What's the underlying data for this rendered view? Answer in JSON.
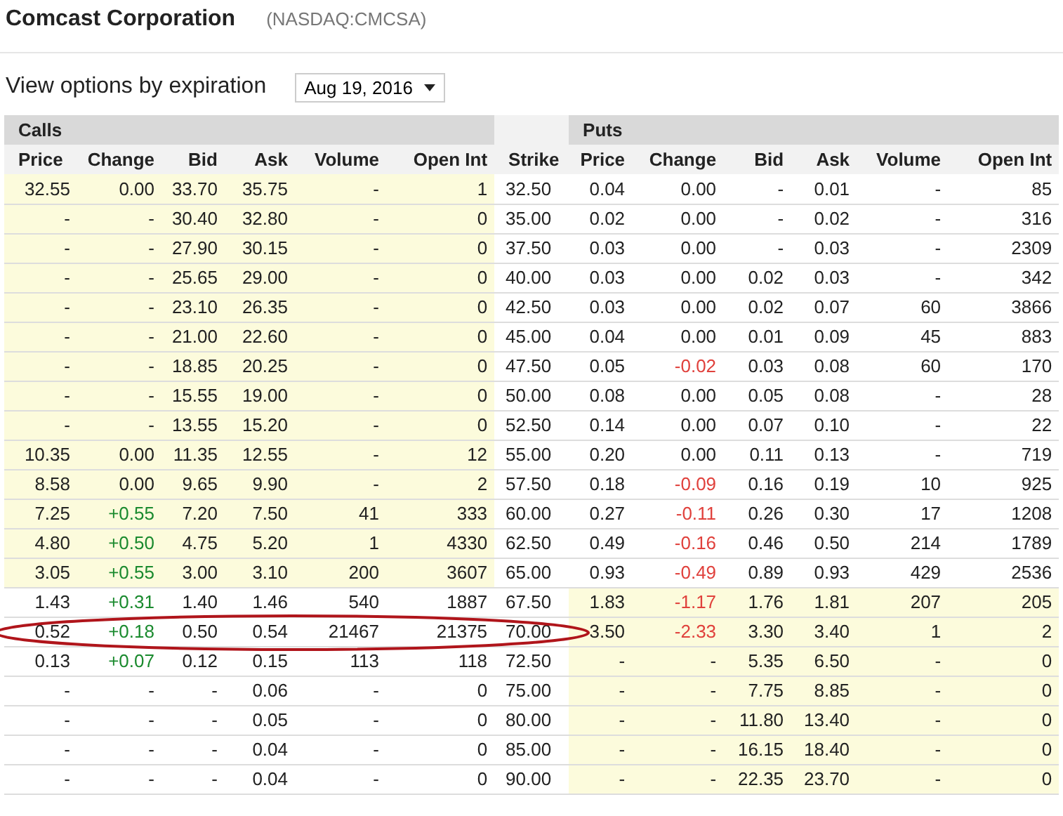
{
  "company": {
    "name": "Comcast Corporation",
    "ticker": "(NASDAQ:CMCSA)"
  },
  "expiration": {
    "label": "View options by expiration",
    "value": "Aug 19, 2016"
  },
  "table": {
    "calls_title": "Calls",
    "puts_title": "Puts",
    "call_columns": [
      "Price",
      "Change",
      "Bid",
      "Ask",
      "Volume",
      "Open Int"
    ],
    "strike_column": "Strike",
    "put_columns": [
      "Price",
      "Change",
      "Bid",
      "Ask",
      "Volume",
      "Open Int"
    ],
    "rows": [
      {
        "strike": "32.50",
        "circled": false,
        "call": {
          "price": "32.55",
          "change": {
            "value": "0.00",
            "color": "#222222"
          },
          "bid": "33.70",
          "ask": "35.75",
          "volume": "-",
          "open_int": "1",
          "in_the_money": true
        },
        "put": {
          "price": "0.04",
          "change": {
            "value": "0.00",
            "color": "#222222"
          },
          "bid": "-",
          "ask": "0.01",
          "volume": "-",
          "open_int": "85",
          "in_the_money": false
        }
      },
      {
        "strike": "35.00",
        "circled": false,
        "call": {
          "price": "-",
          "change": {
            "value": "-",
            "color": "#222222"
          },
          "bid": "30.40",
          "ask": "32.80",
          "volume": "-",
          "open_int": "0",
          "in_the_money": true
        },
        "put": {
          "price": "0.02",
          "change": {
            "value": "0.00",
            "color": "#222222"
          },
          "bid": "-",
          "ask": "0.02",
          "volume": "-",
          "open_int": "316",
          "in_the_money": false
        }
      },
      {
        "strike": "37.50",
        "circled": false,
        "call": {
          "price": "-",
          "change": {
            "value": "-",
            "color": "#222222"
          },
          "bid": "27.90",
          "ask": "30.15",
          "volume": "-",
          "open_int": "0",
          "in_the_money": true
        },
        "put": {
          "price": "0.03",
          "change": {
            "value": "0.00",
            "color": "#222222"
          },
          "bid": "-",
          "ask": "0.03",
          "volume": "-",
          "open_int": "2309",
          "in_the_money": false
        }
      },
      {
        "strike": "40.00",
        "circled": false,
        "call": {
          "price": "-",
          "change": {
            "value": "-",
            "color": "#222222"
          },
          "bid": "25.65",
          "ask": "29.00",
          "volume": "-",
          "open_int": "0",
          "in_the_money": true
        },
        "put": {
          "price": "0.03",
          "change": {
            "value": "0.00",
            "color": "#222222"
          },
          "bid": "0.02",
          "ask": "0.03",
          "volume": "-",
          "open_int": "342",
          "in_the_money": false
        }
      },
      {
        "strike": "42.50",
        "circled": false,
        "call": {
          "price": "-",
          "change": {
            "value": "-",
            "color": "#222222"
          },
          "bid": "23.10",
          "ask": "26.35",
          "volume": "-",
          "open_int": "0",
          "in_the_money": true
        },
        "put": {
          "price": "0.03",
          "change": {
            "value": "0.00",
            "color": "#222222"
          },
          "bid": "0.02",
          "ask": "0.07",
          "volume": "60",
          "open_int": "3866",
          "in_the_money": false
        }
      },
      {
        "strike": "45.00",
        "circled": false,
        "call": {
          "price": "-",
          "change": {
            "value": "-",
            "color": "#222222"
          },
          "bid": "21.00",
          "ask": "22.60",
          "volume": "-",
          "open_int": "0",
          "in_the_money": true
        },
        "put": {
          "price": "0.04",
          "change": {
            "value": "0.00",
            "color": "#222222"
          },
          "bid": "0.01",
          "ask": "0.09",
          "volume": "45",
          "open_int": "883",
          "in_the_money": false
        }
      },
      {
        "strike": "47.50",
        "circled": false,
        "call": {
          "price": "-",
          "change": {
            "value": "-",
            "color": "#222222"
          },
          "bid": "18.85",
          "ask": "20.25",
          "volume": "-",
          "open_int": "0",
          "in_the_money": true
        },
        "put": {
          "price": "0.05",
          "change": {
            "value": "-0.02",
            "color": "#e0413c"
          },
          "bid": "0.03",
          "ask": "0.08",
          "volume": "60",
          "open_int": "170",
          "in_the_money": false
        }
      },
      {
        "strike": "50.00",
        "circled": false,
        "call": {
          "price": "-",
          "change": {
            "value": "-",
            "color": "#222222"
          },
          "bid": "15.55",
          "ask": "19.00",
          "volume": "-",
          "open_int": "0",
          "in_the_money": true
        },
        "put": {
          "price": "0.08",
          "change": {
            "value": "0.00",
            "color": "#222222"
          },
          "bid": "0.05",
          "ask": "0.08",
          "volume": "-",
          "open_int": "28",
          "in_the_money": false
        }
      },
      {
        "strike": "52.50",
        "circled": false,
        "call": {
          "price": "-",
          "change": {
            "value": "-",
            "color": "#222222"
          },
          "bid": "13.55",
          "ask": "15.20",
          "volume": "-",
          "open_int": "0",
          "in_the_money": true
        },
        "put": {
          "price": "0.14",
          "change": {
            "value": "0.00",
            "color": "#222222"
          },
          "bid": "0.07",
          "ask": "0.10",
          "volume": "-",
          "open_int": "22",
          "in_the_money": false
        }
      },
      {
        "strike": "55.00",
        "circled": false,
        "call": {
          "price": "10.35",
          "change": {
            "value": "0.00",
            "color": "#222222"
          },
          "bid": "11.35",
          "ask": "12.55",
          "volume": "-",
          "open_int": "12",
          "in_the_money": true
        },
        "put": {
          "price": "0.20",
          "change": {
            "value": "0.00",
            "color": "#222222"
          },
          "bid": "0.11",
          "ask": "0.13",
          "volume": "-",
          "open_int": "719",
          "in_the_money": false
        }
      },
      {
        "strike": "57.50",
        "circled": false,
        "call": {
          "price": "8.58",
          "change": {
            "value": "0.00",
            "color": "#222222"
          },
          "bid": "9.65",
          "ask": "9.90",
          "volume": "-",
          "open_int": "2",
          "in_the_money": true
        },
        "put": {
          "price": "0.18",
          "change": {
            "value": "-0.09",
            "color": "#e0413c"
          },
          "bid": "0.16",
          "ask": "0.19",
          "volume": "10",
          "open_int": "925",
          "in_the_money": false
        }
      },
      {
        "strike": "60.00",
        "circled": false,
        "call": {
          "price": "7.25",
          "change": {
            "value": "+0.55",
            "color": "#1a8a2e"
          },
          "bid": "7.20",
          "ask": "7.50",
          "volume": "41",
          "open_int": "333",
          "in_the_money": true
        },
        "put": {
          "price": "0.27",
          "change": {
            "value": "-0.11",
            "color": "#e0413c"
          },
          "bid": "0.26",
          "ask": "0.30",
          "volume": "17",
          "open_int": "1208",
          "in_the_money": false
        }
      },
      {
        "strike": "62.50",
        "circled": false,
        "call": {
          "price": "4.80",
          "change": {
            "value": "+0.50",
            "color": "#1a8a2e"
          },
          "bid": "4.75",
          "ask": "5.20",
          "volume": "1",
          "open_int": "4330",
          "in_the_money": true
        },
        "put": {
          "price": "0.49",
          "change": {
            "value": "-0.16",
            "color": "#e0413c"
          },
          "bid": "0.46",
          "ask": "0.50",
          "volume": "214",
          "open_int": "1789",
          "in_the_money": false
        }
      },
      {
        "strike": "65.00",
        "circled": false,
        "call": {
          "price": "3.05",
          "change": {
            "value": "+0.55",
            "color": "#1a8a2e"
          },
          "bid": "3.00",
          "ask": "3.10",
          "volume": "200",
          "open_int": "3607",
          "in_the_money": true
        },
        "put": {
          "price": "0.93",
          "change": {
            "value": "-0.49",
            "color": "#e0413c"
          },
          "bid": "0.89",
          "ask": "0.93",
          "volume": "429",
          "open_int": "2536",
          "in_the_money": false
        }
      },
      {
        "strike": "67.50",
        "circled": false,
        "call": {
          "price": "1.43",
          "change": {
            "value": "+0.31",
            "color": "#1a8a2e"
          },
          "bid": "1.40",
          "ask": "1.46",
          "volume": "540",
          "open_int": "1887",
          "in_the_money": false
        },
        "put": {
          "price": "1.83",
          "change": {
            "value": "-1.17",
            "color": "#e0413c"
          },
          "bid": "1.76",
          "ask": "1.81",
          "volume": "207",
          "open_int": "205",
          "in_the_money": true
        }
      },
      {
        "strike": "70.00",
        "circled": true,
        "call": {
          "price": "0.52",
          "change": {
            "value": "+0.18",
            "color": "#1a8a2e"
          },
          "bid": "0.50",
          "ask": "0.54",
          "volume": "21467",
          "open_int": "21375",
          "in_the_money": false
        },
        "put": {
          "price": "3.50",
          "change": {
            "value": "-2.33",
            "color": "#e0413c"
          },
          "bid": "3.30",
          "ask": "3.40",
          "volume": "1",
          "open_int": "2",
          "in_the_money": true
        }
      },
      {
        "strike": "72.50",
        "circled": false,
        "call": {
          "price": "0.13",
          "change": {
            "value": "+0.07",
            "color": "#1a8a2e"
          },
          "bid": "0.12",
          "ask": "0.15",
          "volume": "113",
          "open_int": "118",
          "in_the_money": false
        },
        "put": {
          "price": "-",
          "change": {
            "value": "-",
            "color": "#222222"
          },
          "bid": "5.35",
          "ask": "6.50",
          "volume": "-",
          "open_int": "0",
          "in_the_money": true
        }
      },
      {
        "strike": "75.00",
        "circled": false,
        "call": {
          "price": "-",
          "change": {
            "value": "-",
            "color": "#222222"
          },
          "bid": "-",
          "ask": "0.06",
          "volume": "-",
          "open_int": "0",
          "in_the_money": false
        },
        "put": {
          "price": "-",
          "change": {
            "value": "-",
            "color": "#222222"
          },
          "bid": "7.75",
          "ask": "8.85",
          "volume": "-",
          "open_int": "0",
          "in_the_money": true
        }
      },
      {
        "strike": "80.00",
        "circled": false,
        "call": {
          "price": "-",
          "change": {
            "value": "-",
            "color": "#222222"
          },
          "bid": "-",
          "ask": "0.05",
          "volume": "-",
          "open_int": "0",
          "in_the_money": false
        },
        "put": {
          "price": "-",
          "change": {
            "value": "-",
            "color": "#222222"
          },
          "bid": "11.80",
          "ask": "13.40",
          "volume": "-",
          "open_int": "0",
          "in_the_money": true
        }
      },
      {
        "strike": "85.00",
        "circled": false,
        "call": {
          "price": "-",
          "change": {
            "value": "-",
            "color": "#222222"
          },
          "bid": "-",
          "ask": "0.04",
          "volume": "-",
          "open_int": "0",
          "in_the_money": false
        },
        "put": {
          "price": "-",
          "change": {
            "value": "-",
            "color": "#222222"
          },
          "bid": "16.15",
          "ask": "18.40",
          "volume": "-",
          "open_int": "0",
          "in_the_money": true
        }
      },
      {
        "strike": "90.00",
        "circled": false,
        "call": {
          "price": "-",
          "change": {
            "value": "-",
            "color": "#222222"
          },
          "bid": "-",
          "ask": "0.04",
          "volume": "-",
          "open_int": "0",
          "in_the_money": false
        },
        "put": {
          "price": "-",
          "change": {
            "value": "-",
            "color": "#222222"
          },
          "bid": "22.35",
          "ask": "23.70",
          "volume": "-",
          "open_int": "0",
          "in_the_money": true
        }
      }
    ]
  }
}
